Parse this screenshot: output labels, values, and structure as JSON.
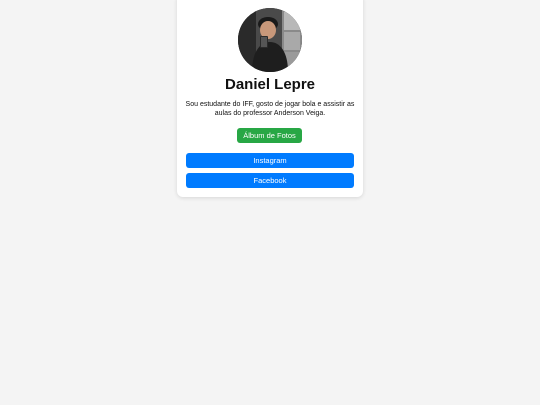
{
  "profile": {
    "name": "Daniel Lepre",
    "bio": "Sou estudante do IFF, gosto de jogar bola e assistir as aulas do professor Anderson Veiga.",
    "avatar_icon": "profile-photo"
  },
  "buttons": {
    "album": "Álbum de Fotos",
    "instagram": "Instagram",
    "facebook": "Facebook"
  },
  "colors": {
    "background": "#f4f4f4",
    "card": "#ffffff",
    "album_button": "#28a745",
    "social_button": "#007bff"
  }
}
